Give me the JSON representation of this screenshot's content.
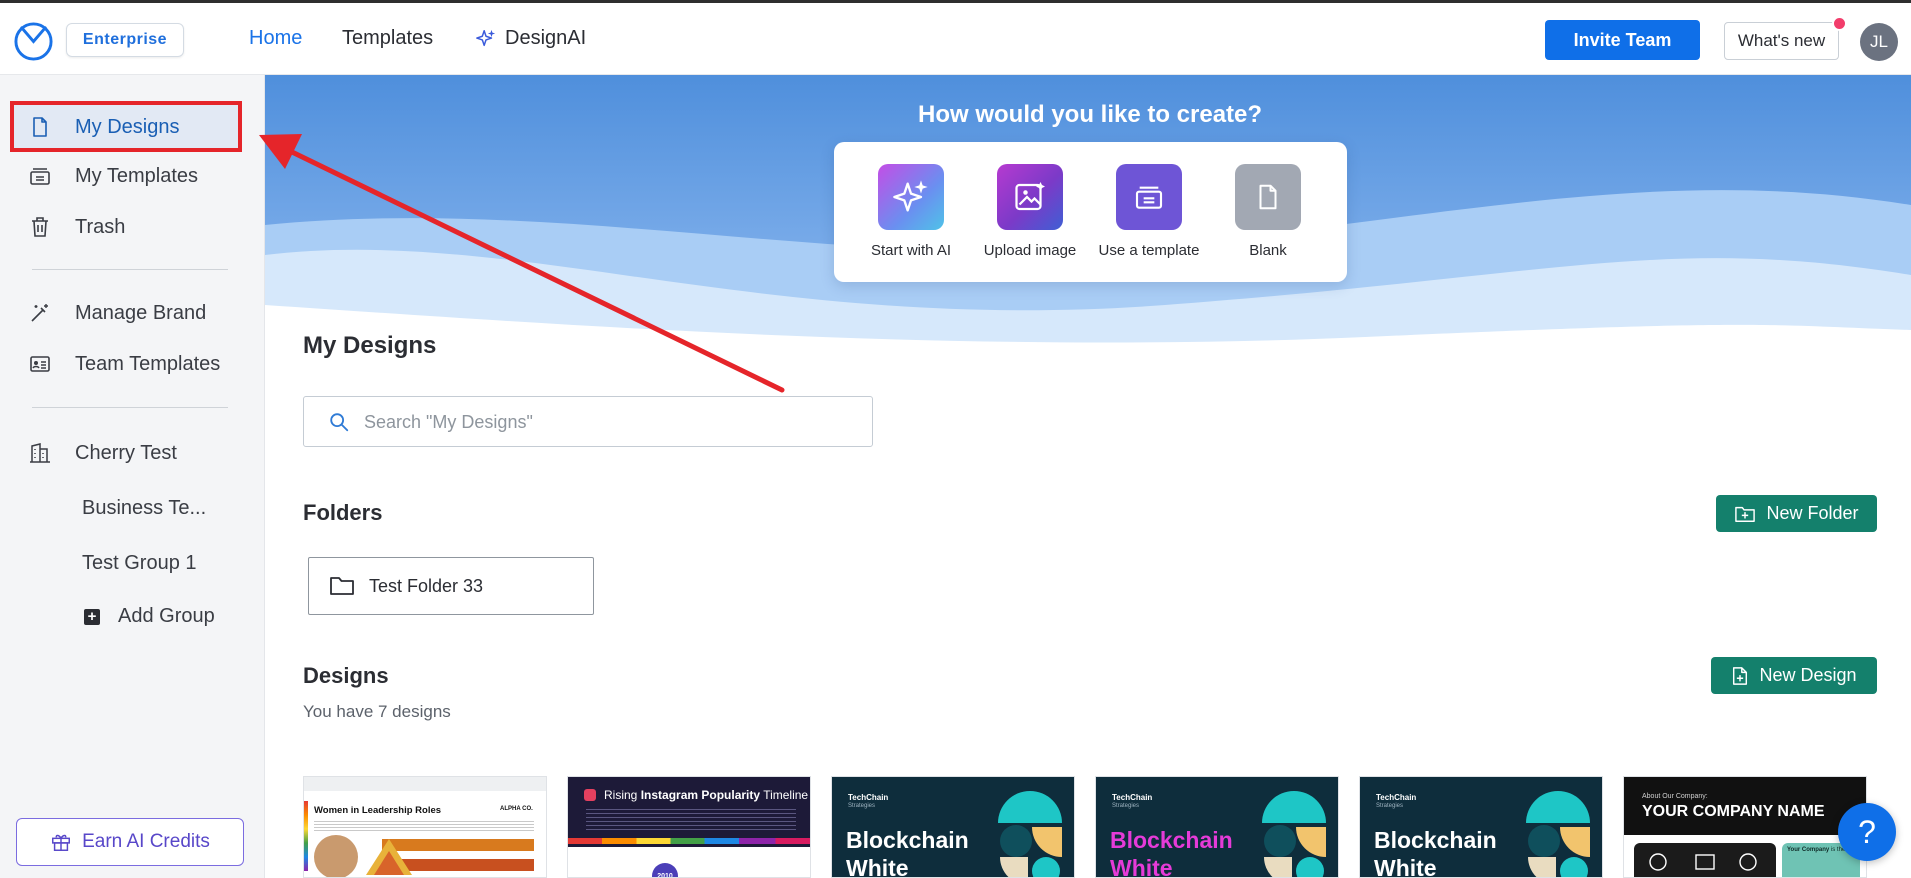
{
  "header": {
    "logo_icon": "clock-logo-icon",
    "plan_badge": "Enterprise",
    "nav": [
      {
        "label": "Home",
        "active": true
      },
      {
        "label": "Templates",
        "active": false
      },
      {
        "label": "DesignAI",
        "active": false,
        "icon": "sparkle-icon"
      }
    ],
    "invite_button": "Invite Team",
    "whats_new_button": "What's new",
    "avatar_initials": "JL"
  },
  "sidebar": {
    "items": [
      {
        "label": "My Designs",
        "icon": "document-icon",
        "active": true
      },
      {
        "label": "My Templates",
        "icon": "template-stack-icon",
        "active": false
      },
      {
        "label": "Trash",
        "icon": "trash-icon",
        "active": false
      },
      {
        "label": "Manage Brand",
        "icon": "magic-wand-icon",
        "active": false
      },
      {
        "label": "Team Templates",
        "icon": "team-templates-icon",
        "active": false
      },
      {
        "label": "Cherry Test",
        "icon": "building-icon",
        "active": false
      }
    ],
    "groups": [
      "Business Te...",
      "Test Group 1"
    ],
    "add_group": "Add Group",
    "earn_credits": "Earn AI Credits"
  },
  "banner": {
    "title": "How would you like to create?",
    "options": [
      {
        "label": "Start with AI",
        "icon": "sparkle-icon"
      },
      {
        "label": "Upload image",
        "icon": "image-sparkle-icon"
      },
      {
        "label": "Use a template",
        "icon": "template-icon"
      },
      {
        "label": "Blank",
        "icon": "blank-page-icon"
      }
    ]
  },
  "main": {
    "title": "My Designs",
    "search_placeholder": "Search \"My Designs\"",
    "folders_heading": "Folders",
    "new_folder_button": "New Folder",
    "folders": [
      {
        "name": "Test Folder 33"
      }
    ],
    "designs_heading": "Designs",
    "designs_count": "You have 7 designs",
    "new_design_button": "New Design",
    "design_cards": [
      {
        "title": "Women in Leadership Roles",
        "brand": "ALPHA CO."
      },
      {
        "title_prefix": "Rising",
        "title_bold": "Instagram Popularity",
        "title_suffix": "Timeline",
        "year": "2010"
      },
      {
        "brand": "TechChain",
        "brand_sub": "Strategies",
        "title_line1": "Blockchain",
        "title_line2": "White",
        "title_color": "#ffffff"
      },
      {
        "brand": "TechChain",
        "brand_sub": "Strategies",
        "title_line1": "Blockchain",
        "title_line2": "White",
        "title_color": "#e53bd8"
      },
      {
        "brand": "TechChain",
        "brand_sub": "Strategies",
        "title_line1": "Blockchain",
        "title_line2": "White",
        "title_color": "#ffffff"
      },
      {
        "kicker": "About Our Company:",
        "title": "YOUR COMPANY NAME",
        "body_bold": "Your Company",
        "body": "is the"
      }
    ]
  },
  "help_button": "?",
  "colors": {
    "accent_blue": "#0f6fe8",
    "teal_button": "#14806c",
    "annotation_red": "#e5252a"
  }
}
